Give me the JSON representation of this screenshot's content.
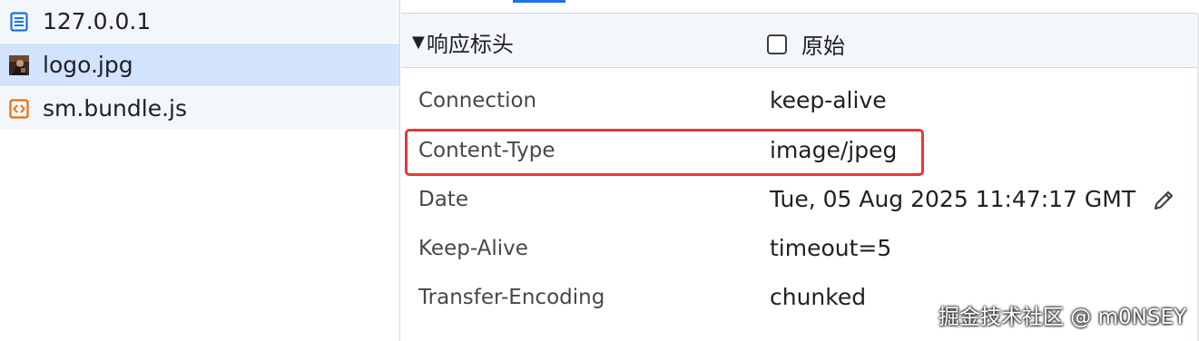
{
  "request_list": {
    "items": [
      {
        "label": "127.0.0.1",
        "icon": "document-icon"
      },
      {
        "label": "logo.jpg",
        "icon": "image-thumbnail-icon",
        "selected": true
      },
      {
        "label": "sm.bundle.js",
        "icon": "script-icon"
      }
    ]
  },
  "headers_panel": {
    "section_title": "响应标头",
    "raw_label": "原始",
    "raw_checked": false,
    "rows": [
      {
        "name": "Connection",
        "value": "keep-alive"
      },
      {
        "name": "Content-Type",
        "value": "image/jpeg"
      },
      {
        "name": "Date",
        "value": "Tue, 05 Aug 2025 11:47:17 GMT"
      },
      {
        "name": "Keep-Alive",
        "value": "timeout=5"
      },
      {
        "name": "Transfer-Encoding",
        "value": "chunked"
      }
    ]
  },
  "watermark": "掘金技术社区 @ m0NSEY",
  "colors": {
    "selected_row": "#d3e3fd",
    "accent": "#1a73e8",
    "highlight": "#e53935",
    "script_icon": "#e8710a"
  }
}
